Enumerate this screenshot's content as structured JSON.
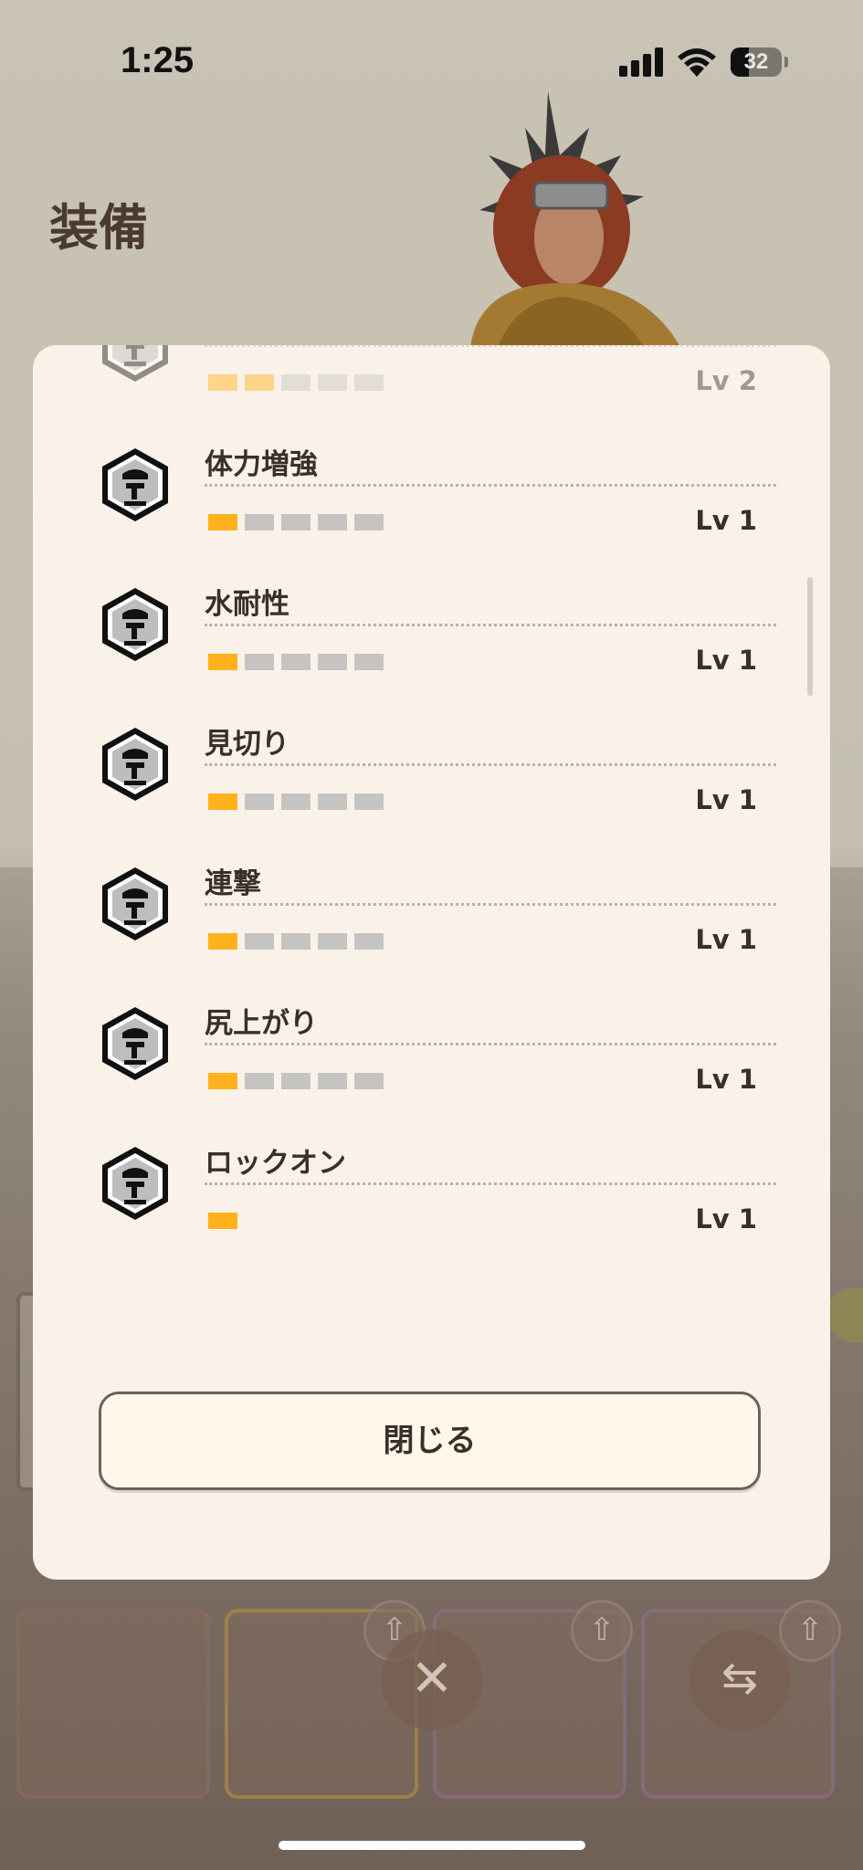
{
  "status": {
    "time": "1:25",
    "battery": "32"
  },
  "header": {
    "title": "装備"
  },
  "skills": [
    {
      "name": "",
      "level": "Lv 2",
      "filled": 2,
      "total": 5,
      "faded": true
    },
    {
      "name": "体力増強",
      "level": "Lv 1",
      "filled": 1,
      "total": 5
    },
    {
      "name": "水耐性",
      "level": "Lv 1",
      "filled": 1,
      "total": 5
    },
    {
      "name": "見切り",
      "level": "Lv 1",
      "filled": 1,
      "total": 5
    },
    {
      "name": "連撃",
      "level": "Lv 1",
      "filled": 1,
      "total": 5
    },
    {
      "name": "尻上がり",
      "level": "Lv 1",
      "filled": 1,
      "total": 5
    },
    {
      "name": "ロックオン",
      "level": "Lv 1",
      "filled": 1,
      "total": 1
    }
  ],
  "modal": {
    "close_label": "閉じる"
  },
  "colors": {
    "level_on": "#ffb21c",
    "level_off": "#c6c4c2",
    "panel": "#faf2e8",
    "text": "#3b2f28"
  },
  "icons": {
    "skill": "skill-emblem-icon"
  }
}
